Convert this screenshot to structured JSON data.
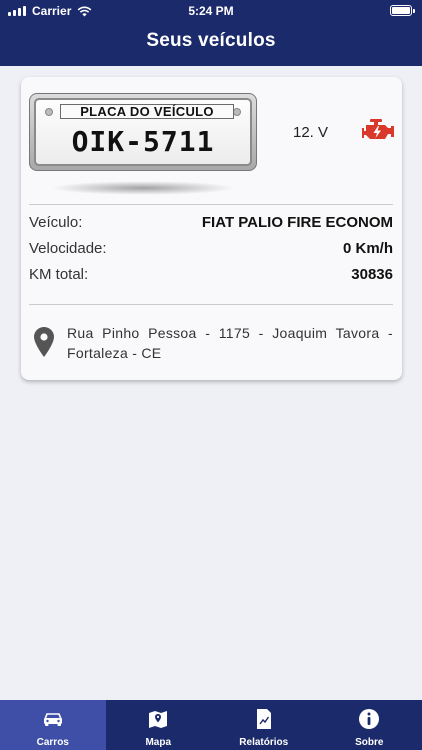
{
  "status_bar": {
    "carrier": "Carrier",
    "time": "5:24 PM"
  },
  "header": {
    "title": "Seus veículos"
  },
  "vehicle": {
    "plate_header": "PLACA DO VEÍCULO",
    "plate_number": "OIK-5711",
    "voltage": "12. V",
    "engine_icon": "engine-alert-icon",
    "engine_icon_color": "#d9382a",
    "model_label": "Veículo:",
    "model_value": "FIAT PALIO FIRE ECONOM",
    "speed_label": "Velocidade:",
    "speed_value": "0 Km/h",
    "km_label": "KM total:",
    "km_value": "30836",
    "address": "Rua Pinho Pessoa - 1175 - Joaquim Tavora - Fortaleza - CE"
  },
  "tabs": [
    {
      "label": "Carros",
      "icon": "car-icon",
      "active": true
    },
    {
      "label": "Mapa",
      "icon": "map-icon",
      "active": false
    },
    {
      "label": "Relatórios",
      "icon": "report-icon",
      "active": false
    },
    {
      "label": "Sobre",
      "icon": "info-icon",
      "active": false
    }
  ],
  "colors": {
    "brand": "#1b2a6b",
    "tab_active": "#3f4fa7",
    "alert": "#d9382a"
  }
}
